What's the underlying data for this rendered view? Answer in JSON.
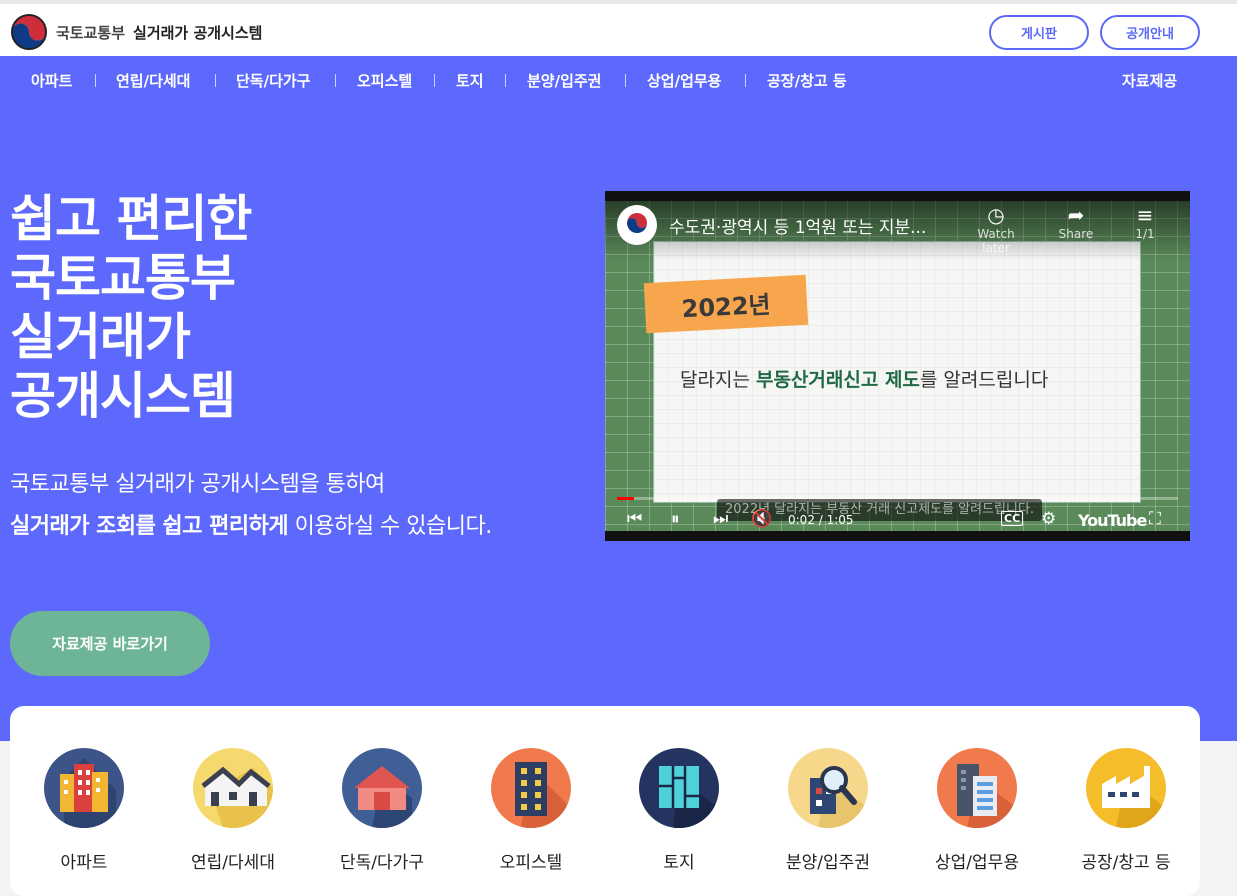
{
  "header": {
    "org_name": "국토교통부",
    "system_name": "실거래가 공개시스템",
    "buttons": {
      "board": "게시판",
      "notice": "공개안내"
    }
  },
  "nav": {
    "items": [
      "아파트",
      "연립/다세대",
      "단독/다가구",
      "오피스텔",
      "토지",
      "분양/입주권",
      "상업/업무용",
      "공장/창고 등"
    ],
    "data_service": "자료제공"
  },
  "hero": {
    "title_lines": [
      "쉽고 편리한",
      "국토교통부",
      "실거래가",
      "공개시스템"
    ],
    "desc_line1": "국토교통부 실거래가 공개시스템을 통하여",
    "desc_line2_bold": "실거래가 조회를 쉽고 편리하게",
    "desc_line2_rest": " 이용하실 수 있습니다.",
    "cta": "자료제공 바로가기"
  },
  "video": {
    "title": "수도권·광역시 등 1억원 또는 지분...",
    "watch_later": "Watch later",
    "share": "Share",
    "playlist_count": "1/1",
    "tag": "2022년",
    "text_pre": "달라지는 ",
    "text_bold": "부동산거래신고 제도",
    "text_post": "를 알려드립니다",
    "caption": "2022년 달라지는 부동산 거래 신고제도를 알려드립니다.",
    "time": "0:02 / 1:05",
    "progress": 0.03,
    "cc": "CC",
    "brand": "YouTube"
  },
  "categories": [
    {
      "label": "아파트",
      "icon": "apartment-icon",
      "bg": "#3c5487"
    },
    {
      "label": "연립/다세대",
      "icon": "row-house-icon",
      "bg": "#f5d96e"
    },
    {
      "label": "단독/다가구",
      "icon": "house-icon",
      "bg": "#3f5f96"
    },
    {
      "label": "오피스텔",
      "icon": "officetel-icon",
      "bg": "#f07a4c"
    },
    {
      "label": "토지",
      "icon": "land-icon",
      "bg": "#24335f"
    },
    {
      "label": "분양/입주권",
      "icon": "presale-icon",
      "bg": "#f7d88a"
    },
    {
      "label": "상업/업무용",
      "icon": "commercial-icon",
      "bg": "#f07a4c"
    },
    {
      "label": "공장/창고 등",
      "icon": "factory-icon",
      "bg": "#f6bd2a"
    }
  ],
  "colors": {
    "primary": "#5d68fc",
    "cta": "#6eb497",
    "accent_border": "#5b69f6"
  }
}
